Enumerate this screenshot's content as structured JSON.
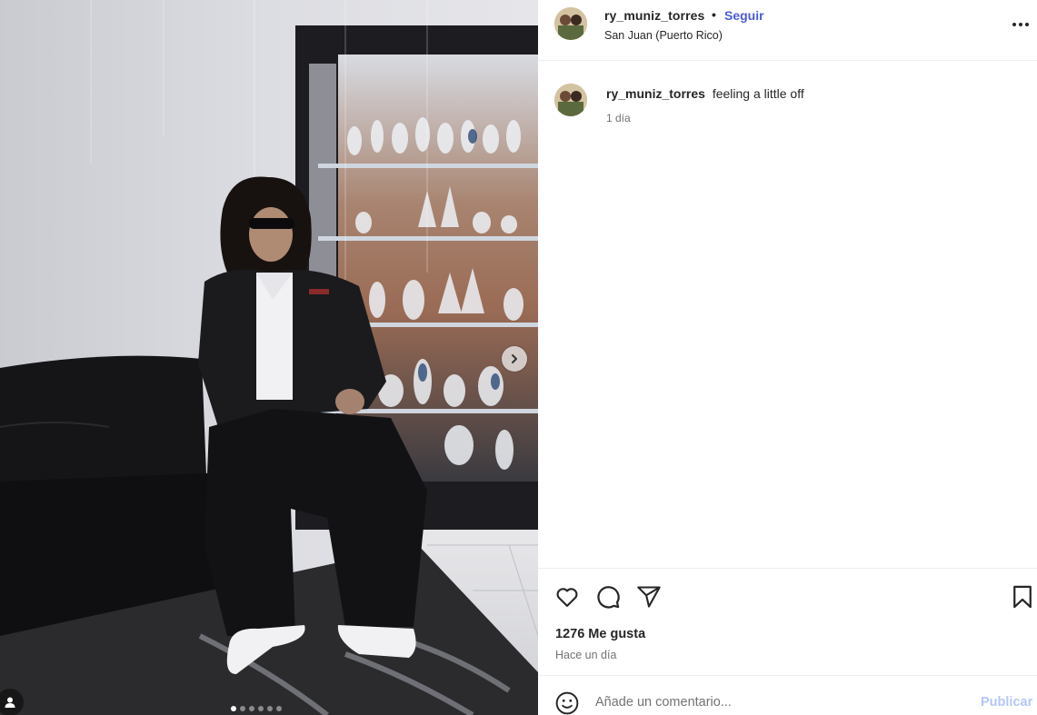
{
  "post": {
    "media": {
      "image_description": "Photo of person in dark jacket and white sneakers sitting on a black leather couch next to a glass display cabinet",
      "slide_count": 6,
      "active_slide": 1,
      "next_icon": "chevron-right-icon",
      "tag_icon": "user-icon"
    },
    "header": {
      "username": "ry_muniz_torres",
      "separator": "•",
      "follow_label": "Seguir",
      "location": "San Juan (Puerto Rico)",
      "more_icon": "more-horizontal-icon"
    },
    "caption": {
      "username": "ry_muniz_torres",
      "text": "feeling a little off",
      "time": "1 día"
    },
    "actions": {
      "like_icon": "heart-icon",
      "comment_icon": "comment-icon",
      "share_icon": "send-icon",
      "save_icon": "bookmark-icon"
    },
    "likes": "1276 Me gusta",
    "posted_ago": "Hace un día",
    "comment_box": {
      "emoji_icon": "emoji-icon",
      "placeholder": "Añade un comentario...",
      "publish_label": "Publicar"
    }
  },
  "colors": {
    "link_blue": "#4a5cd6",
    "publish_disabled": "#b3c7f5",
    "secondary_text": "#737373",
    "divider": "#efefef"
  }
}
